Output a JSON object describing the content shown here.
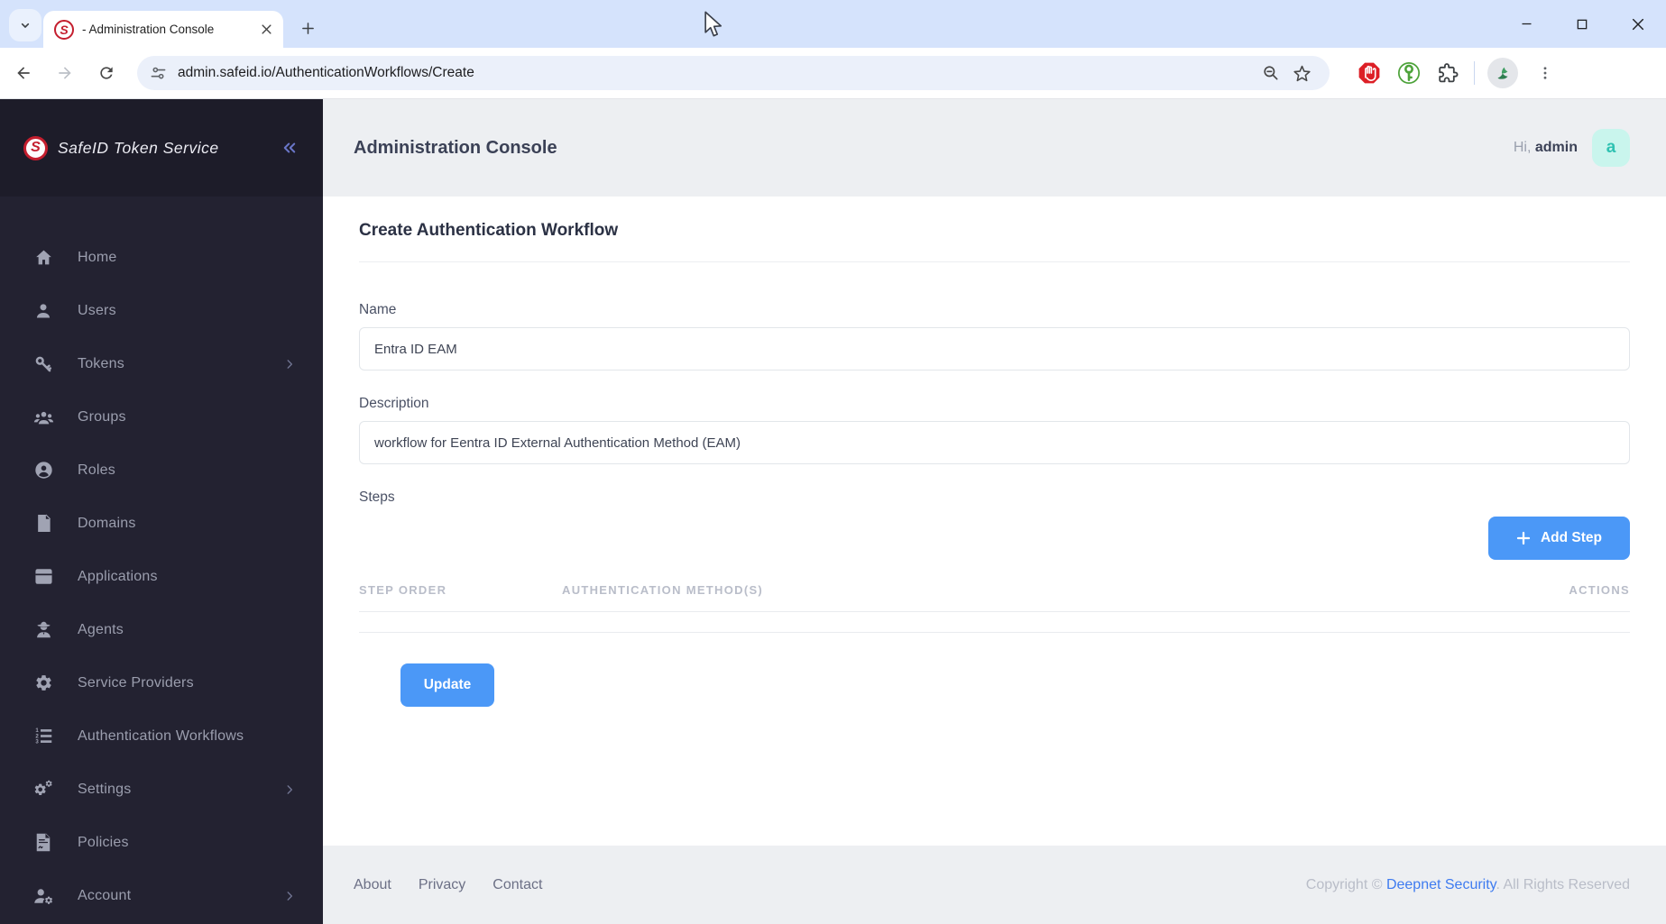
{
  "browser": {
    "tab_title": "- Administration Console",
    "favicon_letter": "S",
    "url": "admin.safeid.io/AuthenticationWorkflows/Create"
  },
  "sidebar": {
    "brand": "SafeID Token Service",
    "logo_letter": "S",
    "items": [
      {
        "label": "Home",
        "icon": "home-icon",
        "has_submenu": false
      },
      {
        "label": "Users",
        "icon": "user-icon",
        "has_submenu": false
      },
      {
        "label": "Tokens",
        "icon": "key-icon",
        "has_submenu": true
      },
      {
        "label": "Groups",
        "icon": "users-icon",
        "has_submenu": false
      },
      {
        "label": "Roles",
        "icon": "user-circle-icon",
        "has_submenu": false
      },
      {
        "label": "Domains",
        "icon": "domain-file-icon",
        "has_submenu": false
      },
      {
        "label": "Applications",
        "icon": "window-icon",
        "has_submenu": false
      },
      {
        "label": "Agents",
        "icon": "agent-icon",
        "has_submenu": false
      },
      {
        "label": "Service Providers",
        "icon": "gear-icon",
        "has_submenu": false
      },
      {
        "label": "Authentication Workflows",
        "icon": "ordered-list-icon",
        "has_submenu": false
      },
      {
        "label": "Settings",
        "icon": "gears-icon",
        "has_submenu": true
      },
      {
        "label": "Policies",
        "icon": "policy-file-icon",
        "has_submenu": false
      },
      {
        "label": "Account",
        "icon": "user-gear-icon",
        "has_submenu": true
      }
    ]
  },
  "header": {
    "title": "Administration Console",
    "greeting_prefix": "Hi,",
    "username": "admin",
    "avatar_letter": "a"
  },
  "page": {
    "title": "Create Authentication Workflow",
    "form": {
      "name_label": "Name",
      "name_value": "Entra ID EAM",
      "description_label": "Description",
      "description_value": "workflow for Eentra ID External Authentication Method (EAM)",
      "steps_label": "Steps",
      "add_step_label": "Add Step",
      "table_headers": [
        "STEP ORDER",
        "AUTHENTICATION METHOD(S)",
        "ACTIONS"
      ],
      "update_label": "Update"
    }
  },
  "footer": {
    "links": [
      "About",
      "Privacy",
      "Contact"
    ],
    "copyright_prefix": "Copyright © ",
    "copyright_link": "Deepnet Security",
    "copyright_suffix": ". All Rights Reserved"
  },
  "colors": {
    "brand_red": "#c41e2e",
    "primary_blue": "#4b98f7",
    "avatar_bg": "#c9f5ed",
    "avatar_text": "#2fc2b2",
    "sidebar_bg": "#232231",
    "titlebar_bg": "#d5e3fc"
  }
}
